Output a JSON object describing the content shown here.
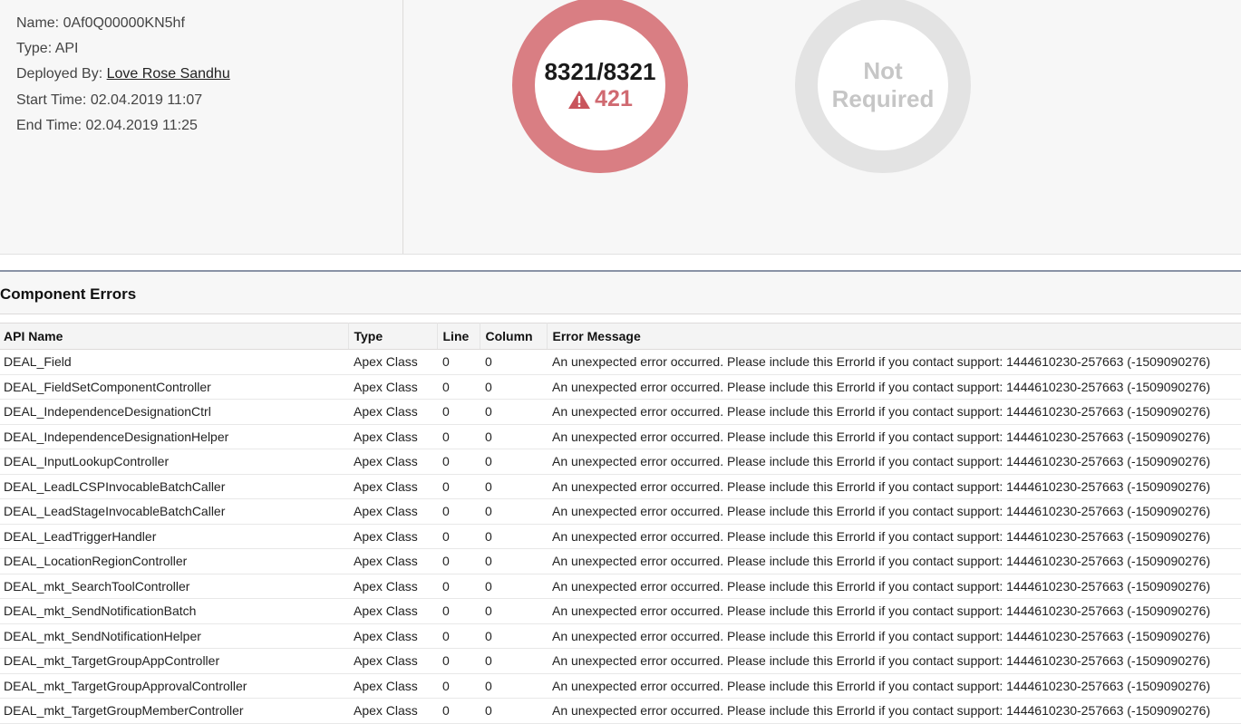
{
  "deployment": {
    "name_label": "Name:",
    "name_value": "0Af0Q00000KN5hf",
    "type_label": "Type:",
    "type_value": "API",
    "deployed_by_label": "Deployed By:",
    "deployed_by_value": "Love Rose Sandhu",
    "start_label": "Start Time:",
    "start_value": "02.04.2019 11:07",
    "end_label": "End Time:",
    "end_value": "02.04.2019 11:25"
  },
  "components_ring": {
    "count": "8321/8321",
    "errors": "421",
    "color": "#d97e83"
  },
  "tests_ring": {
    "line1": "Not",
    "line2": "Required",
    "color": "#e3e3e3"
  },
  "section": {
    "title": "Component Errors"
  },
  "table": {
    "headers": {
      "api_name": "API Name",
      "type": "Type",
      "line": "Line",
      "column": "Column",
      "message": "Error Message"
    },
    "rows": [
      {
        "api_name": "DEAL_Field",
        "type": "Apex Class",
        "line": "0",
        "column": "0",
        "message": "An unexpected error occurred. Please include this ErrorId if you contact support: 1444610230-257663 (-1509090276)"
      },
      {
        "api_name": "DEAL_FieldSetComponentController",
        "type": "Apex Class",
        "line": "0",
        "column": "0",
        "message": "An unexpected error occurred. Please include this ErrorId if you contact support: 1444610230-257663 (-1509090276)"
      },
      {
        "api_name": "DEAL_IndependenceDesignationCtrl",
        "type": "Apex Class",
        "line": "0",
        "column": "0",
        "message": "An unexpected error occurred. Please include this ErrorId if you contact support: 1444610230-257663 (-1509090276)"
      },
      {
        "api_name": "DEAL_IndependenceDesignationHelper",
        "type": "Apex Class",
        "line": "0",
        "column": "0",
        "message": "An unexpected error occurred. Please include this ErrorId if you contact support: 1444610230-257663 (-1509090276)"
      },
      {
        "api_name": "DEAL_InputLookupController",
        "type": "Apex Class",
        "line": "0",
        "column": "0",
        "message": "An unexpected error occurred. Please include this ErrorId if you contact support: 1444610230-257663 (-1509090276)"
      },
      {
        "api_name": "DEAL_LeadLCSPInvocableBatchCaller",
        "type": "Apex Class",
        "line": "0",
        "column": "0",
        "message": "An unexpected error occurred. Please include this ErrorId if you contact support: 1444610230-257663 (-1509090276)"
      },
      {
        "api_name": "DEAL_LeadStageInvocableBatchCaller",
        "type": "Apex Class",
        "line": "0",
        "column": "0",
        "message": "An unexpected error occurred. Please include this ErrorId if you contact support: 1444610230-257663 (-1509090276)"
      },
      {
        "api_name": "DEAL_LeadTriggerHandler",
        "type": "Apex Class",
        "line": "0",
        "column": "0",
        "message": "An unexpected error occurred. Please include this ErrorId if you contact support: 1444610230-257663 (-1509090276)"
      },
      {
        "api_name": "DEAL_LocationRegionController",
        "type": "Apex Class",
        "line": "0",
        "column": "0",
        "message": "An unexpected error occurred. Please include this ErrorId if you contact support: 1444610230-257663 (-1509090276)"
      },
      {
        "api_name": "DEAL_mkt_SearchToolController",
        "type": "Apex Class",
        "line": "0",
        "column": "0",
        "message": "An unexpected error occurred. Please include this ErrorId if you contact support: 1444610230-257663 (-1509090276)"
      },
      {
        "api_name": "DEAL_mkt_SendNotificationBatch",
        "type": "Apex Class",
        "line": "0",
        "column": "0",
        "message": "An unexpected error occurred. Please include this ErrorId if you contact support: 1444610230-257663 (-1509090276)"
      },
      {
        "api_name": "DEAL_mkt_SendNotificationHelper",
        "type": "Apex Class",
        "line": "0",
        "column": "0",
        "message": "An unexpected error occurred. Please include this ErrorId if you contact support: 1444610230-257663 (-1509090276)"
      },
      {
        "api_name": "DEAL_mkt_TargetGroupAppController",
        "type": "Apex Class",
        "line": "0",
        "column": "0",
        "message": "An unexpected error occurred. Please include this ErrorId if you contact support: 1444610230-257663 (-1509090276)"
      },
      {
        "api_name": "DEAL_mkt_TargetGroupApprovalController",
        "type": "Apex Class",
        "line": "0",
        "column": "0",
        "message": "An unexpected error occurred. Please include this ErrorId if you contact support: 1444610230-257663 (-1509090276)"
      },
      {
        "api_name": "DEAL_mkt_TargetGroupMemberController",
        "type": "Apex Class",
        "line": "0",
        "column": "0",
        "message": "An unexpected error occurred. Please include this ErrorId if you contact support: 1444610230-257663 (-1509090276)"
      }
    ]
  }
}
